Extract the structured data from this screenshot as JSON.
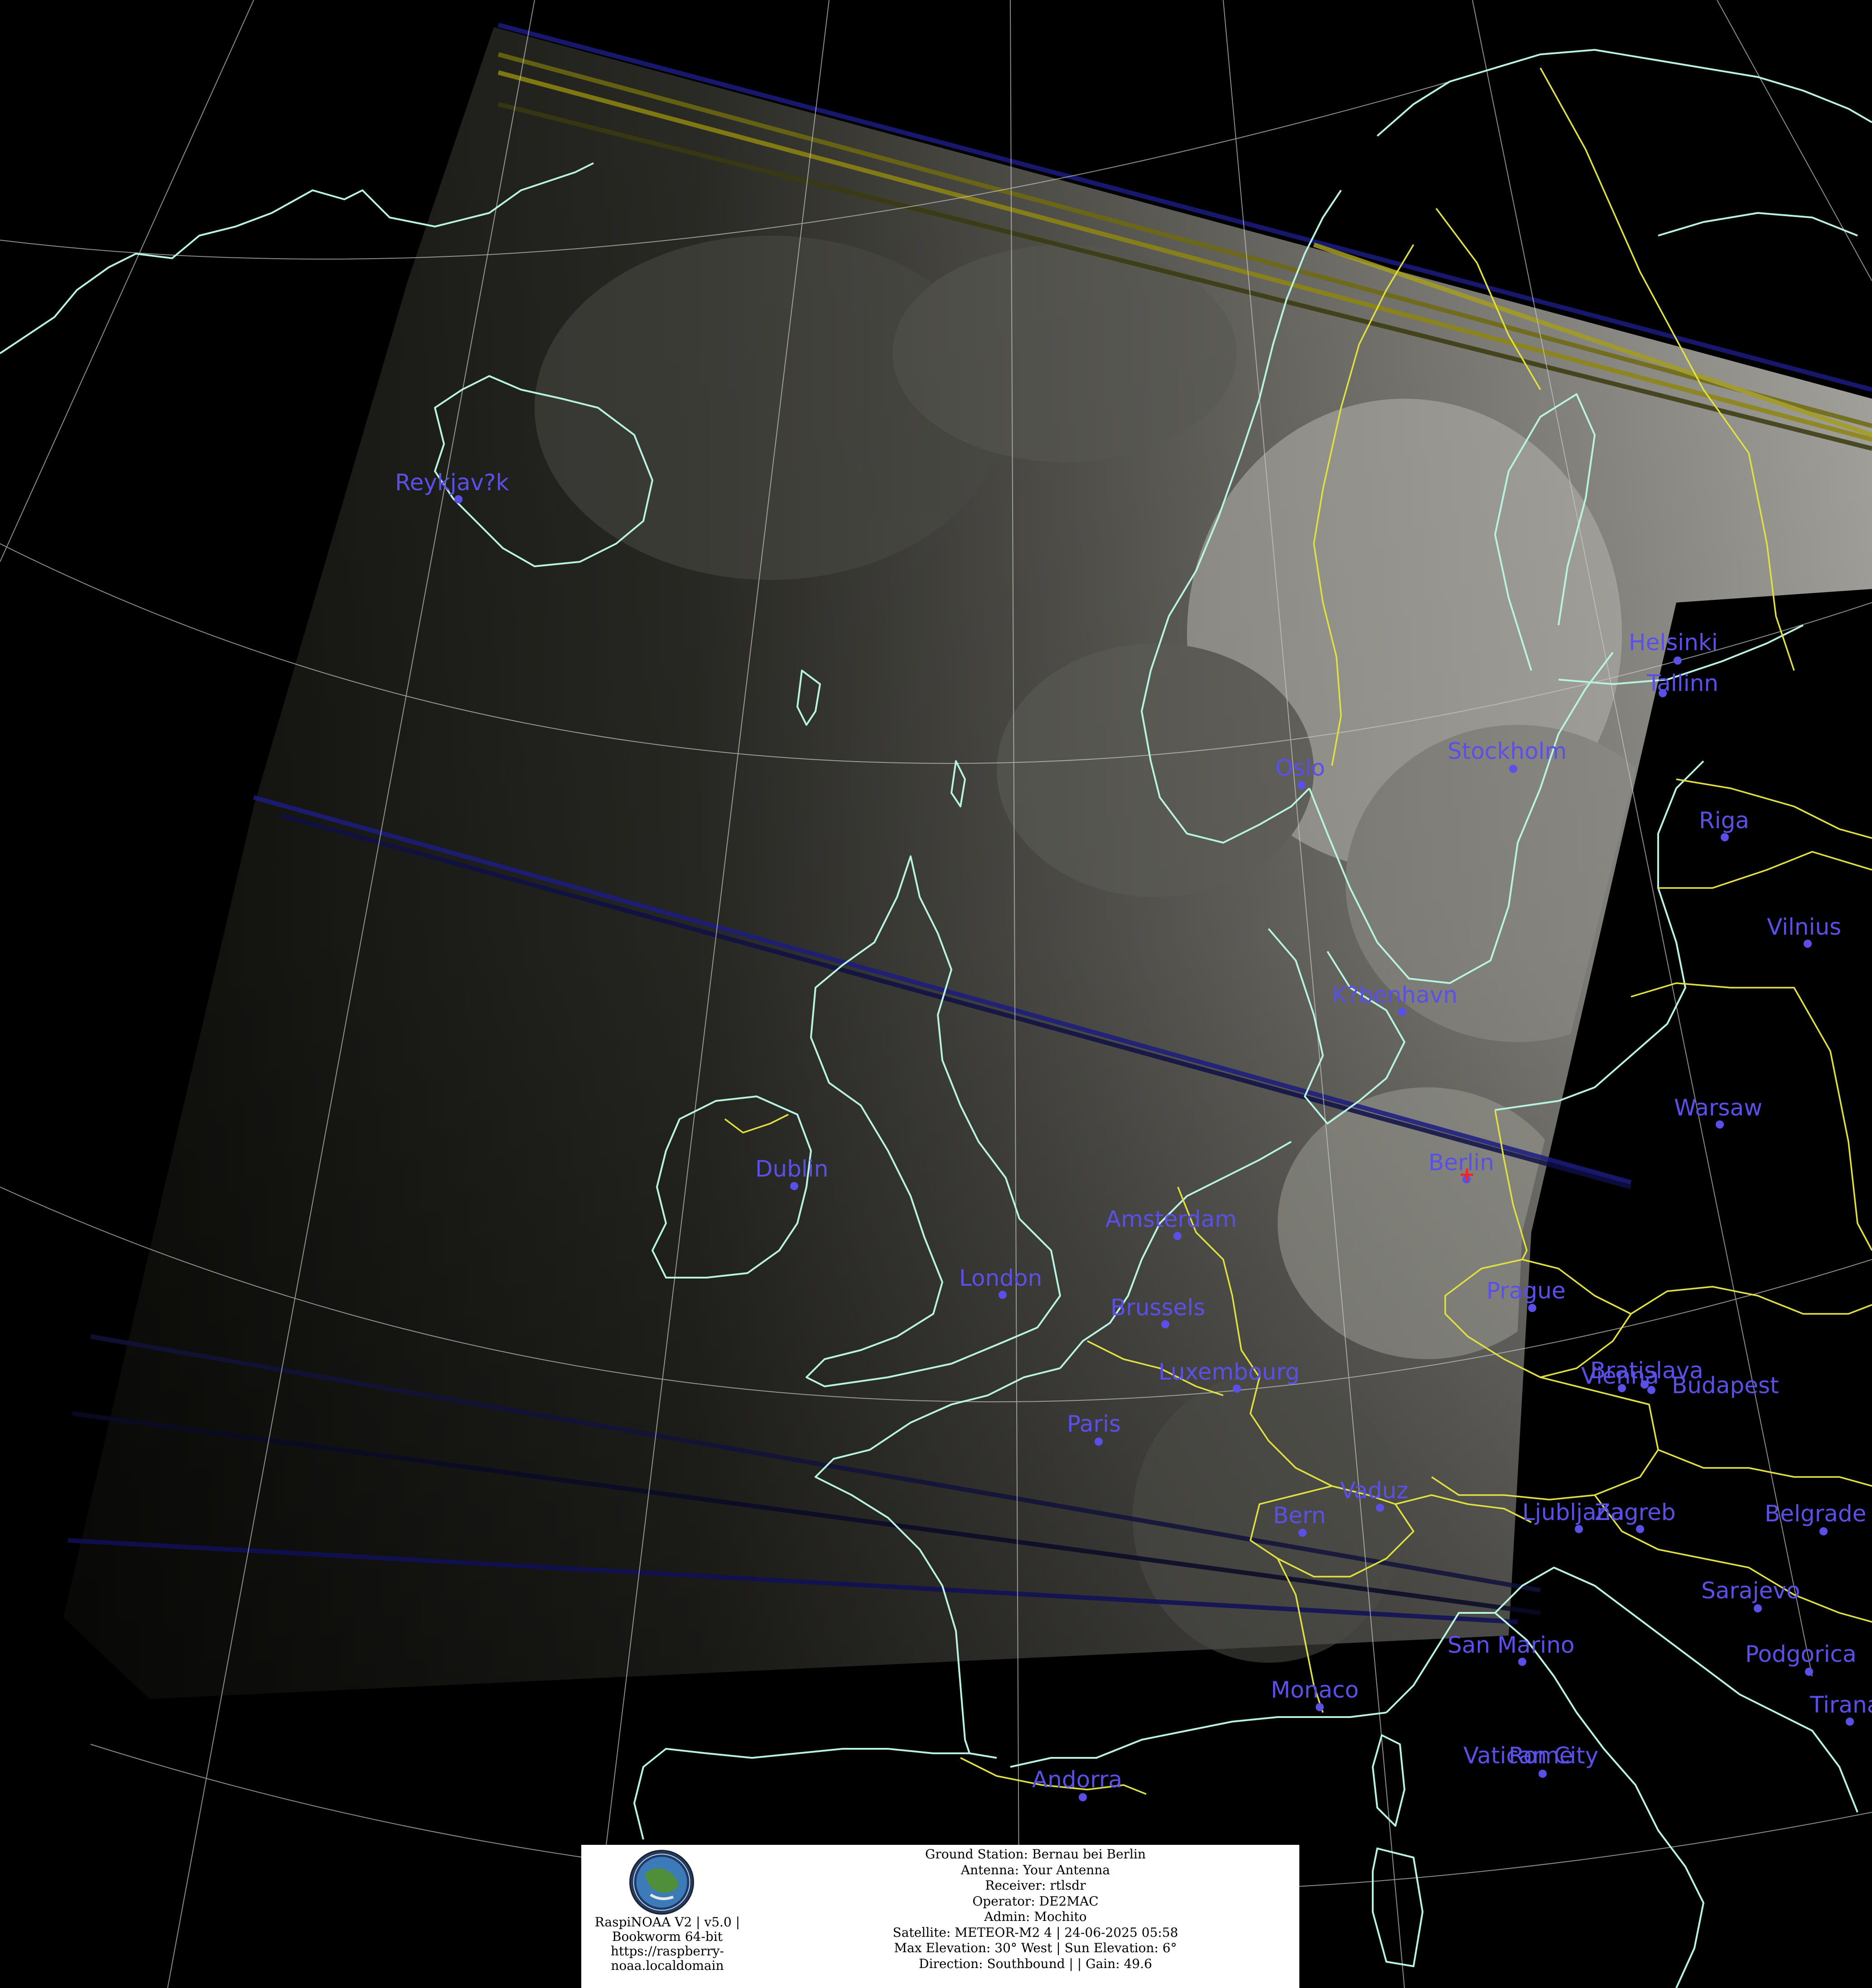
{
  "map": {
    "colors": {
      "background": "#000000",
      "coastline": "#b8f2e0",
      "border": "#e0e040",
      "graticule": "#c8c8c8",
      "city": "#5a50e8",
      "station_marker": "#ff2020"
    },
    "cities": [
      {
        "name": "Reykjav?k"
      },
      {
        "name": "Helsinki"
      },
      {
        "name": "Tallinn"
      },
      {
        "name": "Stockholm"
      },
      {
        "name": "Oslo"
      },
      {
        "name": "Riga"
      },
      {
        "name": "Vilnius"
      },
      {
        "name": "K?benhavn"
      },
      {
        "name": "Warsaw"
      },
      {
        "name": "Dublin"
      },
      {
        "name": "Berlin"
      },
      {
        "name": "Amsterdam"
      },
      {
        "name": "London"
      },
      {
        "name": "Brussels"
      },
      {
        "name": "Prague"
      },
      {
        "name": "Luxembourg"
      },
      {
        "name": "Vienna"
      },
      {
        "name": "Bratislava"
      },
      {
        "name": "Budapest"
      },
      {
        "name": "Paris"
      },
      {
        "name": "Vaduz"
      },
      {
        "name": "Bern"
      },
      {
        "name": "Ljubljana"
      },
      {
        "name": "Zagreb"
      },
      {
        "name": "Belgrade"
      },
      {
        "name": "Sarajevo"
      },
      {
        "name": "San Marino"
      },
      {
        "name": "Podgorica"
      },
      {
        "name": "Monaco"
      },
      {
        "name": "Vatican City"
      },
      {
        "name": "Rome"
      },
      {
        "name": "Andorra"
      },
      {
        "name": "Tirana"
      }
    ]
  },
  "info": {
    "system_lines": [
      "RaspiNOAA V2 | v5.0 |",
      "Bookworm 64-bit",
      "https://raspberry-",
      "noaa.localdomain"
    ],
    "ground_station": "Ground Station: Bernau bei Berlin",
    "antenna": "Antenna: Your Antenna",
    "receiver": "Receiver: rtlsdr",
    "operator": "Operator: DE2MAC",
    "admin": "Admin: Mochito",
    "satellite": "Satellite: METEOR-M2 4 | 24-06-2025 05:58",
    "elevation": "Max Elevation: 30° West | Sun Elevation: 6°",
    "direction": "Direction: Southbound | | Gain: 49.6"
  }
}
